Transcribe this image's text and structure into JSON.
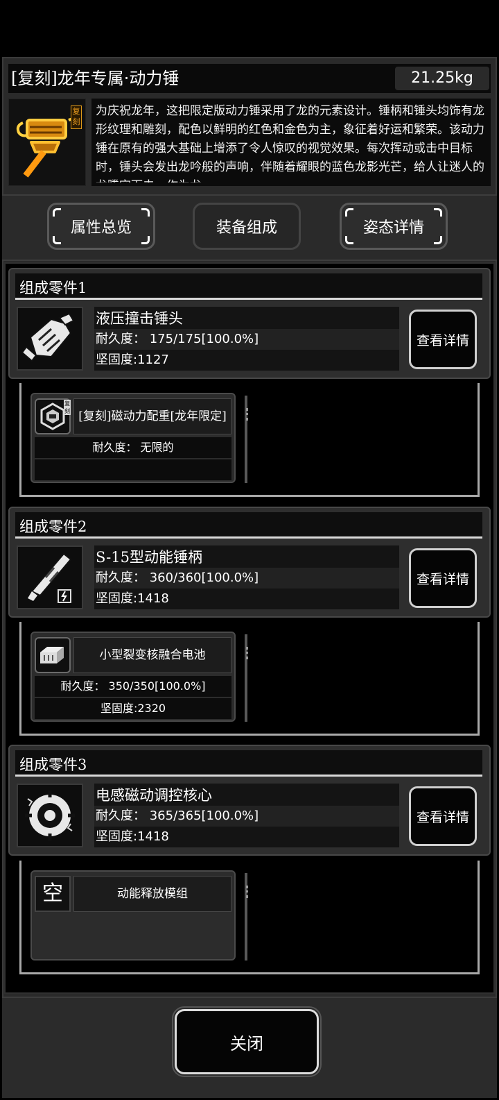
{
  "header": {
    "title": "[复刻]龙年专属·动力锤",
    "weight": "21.25kg",
    "badge": "复刻",
    "description": "为庆祝龙年，这把限定版动力锤采用了龙的元素设计。锤柄和锤头均饰有龙形纹理和雕刻，配色以鲜明的红色和金色为主，象征着好运和繁荣。该动力锤在原有的强大基础上增添了令人惊叹的视觉效果。每次挥动或击中目标时，锤头会发出龙吟般的声响，伴随着耀眼的蓝色龙影光芒，给人让迷人的龙腾空而去，作为龙"
  },
  "tabs": [
    {
      "label": "属性总览",
      "active": false
    },
    {
      "label": "装备组成",
      "active": true
    },
    {
      "label": "姿态详情",
      "active": false
    }
  ],
  "components": [
    {
      "heading": "组成零件1",
      "name": "液压撞击锤头",
      "durability": "耐久度： 175/175[100.0%]",
      "hardness": "坚固度:1127",
      "detail_label": "查看详情",
      "icon": "hammer-head-icon",
      "sub": {
        "name": "[复刻]磁动力配重[龙年限定]",
        "row1": "耐久度： 无限的",
        "row2": "",
        "icon": "magnet-weight-icon",
        "badge": "复刻"
      }
    },
    {
      "heading": "组成零件2",
      "name": "S-15型动能锤柄",
      "durability": "耐久度： 360/360[100.0%]",
      "hardness": "坚固度:1418",
      "detail_label": "查看详情",
      "icon": "hammer-handle-icon",
      "sub": {
        "name": "小型裂变核融合电池",
        "row1": "耐久度：  350/350[100.0%]",
        "row2": "坚固度:2320",
        "icon": "battery-icon"
      }
    },
    {
      "heading": "组成零件3",
      "name": "电感磁动调控核心",
      "durability": "耐久度： 365/365[100.0%]",
      "hardness": "坚固度:1418",
      "detail_label": "查看详情",
      "icon": "core-icon",
      "sub": {
        "name": "动能释放模组",
        "empty_glyph": "空",
        "icon": "empty-slot-icon"
      }
    }
  ],
  "footer": {
    "close_label": "关闭"
  },
  "colors": {
    "accent_gold": "#f0a020",
    "border_light": "#d0d0d0",
    "panel": "#2a2a2a"
  }
}
